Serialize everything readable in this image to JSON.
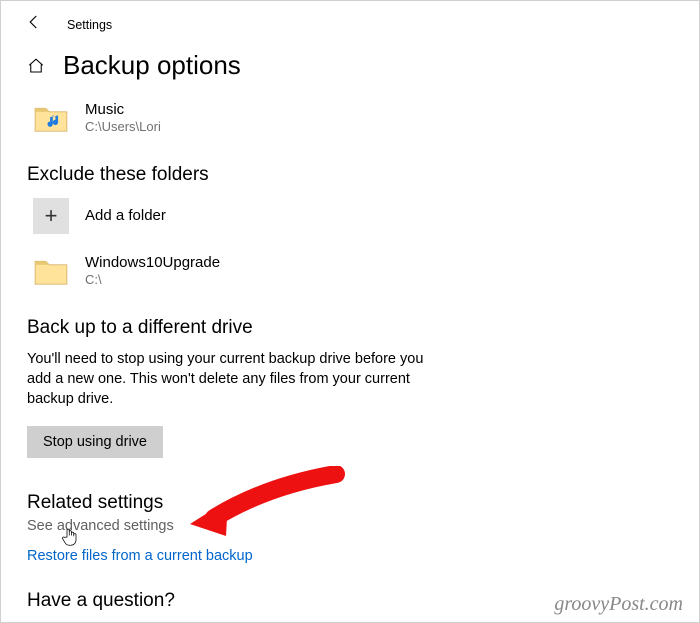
{
  "header": {
    "title": "Settings"
  },
  "page_title": "Backup options",
  "backup_folder": {
    "name": "Music",
    "path": "C:\\Users\\Lori"
  },
  "exclude": {
    "heading": "Exclude these folders",
    "add_label": "Add a folder",
    "items": [
      {
        "name": "Windows10Upgrade",
        "path": "C:\\"
      }
    ]
  },
  "diff_drive": {
    "heading": "Back up to a different drive",
    "desc": "You'll need to stop using your current backup drive before you add a new one. This won't delete any files from your current backup drive.",
    "button": "Stop using drive"
  },
  "related": {
    "heading": "Related settings",
    "advanced": "See advanced settings",
    "restore": "Restore files from a current backup"
  },
  "question_heading": "Have a question?",
  "watermark": "groovyPost.com"
}
